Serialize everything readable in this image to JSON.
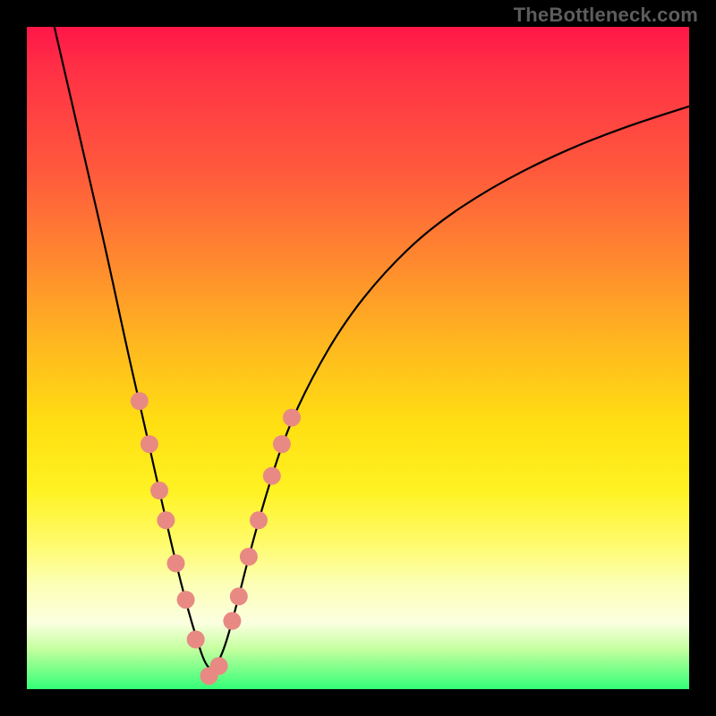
{
  "attribution": "TheBottleneck.com",
  "colors": {
    "background": "#000000",
    "gradient_stops": [
      {
        "pos": 0.0,
        "hex": "#ff1648"
      },
      {
        "pos": 0.06,
        "hex": "#ff2f46"
      },
      {
        "pos": 0.22,
        "hex": "#ff5a3c"
      },
      {
        "pos": 0.36,
        "hex": "#ff8b2e"
      },
      {
        "pos": 0.48,
        "hex": "#ffb81f"
      },
      {
        "pos": 0.6,
        "hex": "#ffdf12"
      },
      {
        "pos": 0.7,
        "hex": "#fff223"
      },
      {
        "pos": 0.78,
        "hex": "#fffb6b"
      },
      {
        "pos": 0.84,
        "hex": "#fcffb4"
      },
      {
        "pos": 0.9,
        "hex": "#fbffe0"
      },
      {
        "pos": 0.94,
        "hex": "#c3ff9e"
      },
      {
        "pos": 1.0,
        "hex": "#33ff77"
      }
    ],
    "curve": "#000000",
    "curve_width": 2.2,
    "marker_fill": "#e88a83",
    "marker_radius": 10
  },
  "chart_data": {
    "type": "line",
    "title": "",
    "xlabel": "",
    "ylabel": "",
    "xlim": [
      0,
      1
    ],
    "ylim": [
      0,
      1
    ],
    "x_min_curve": 0.275,
    "series": [
      {
        "name": "v-curve",
        "x": [
          0.0,
          0.03,
          0.06,
          0.09,
          0.12,
          0.15,
          0.175,
          0.2,
          0.225,
          0.25,
          0.275,
          0.295,
          0.315,
          0.335,
          0.36,
          0.39,
          0.43,
          0.48,
          0.54,
          0.61,
          0.7,
          0.8,
          0.9,
          1.0
        ],
        "y": [
          1.18,
          1.05,
          0.92,
          0.79,
          0.66,
          0.52,
          0.41,
          0.3,
          0.19,
          0.095,
          0.02,
          0.05,
          0.12,
          0.2,
          0.29,
          0.384,
          0.47,
          0.555,
          0.63,
          0.697,
          0.757,
          0.808,
          0.848,
          0.88
        ]
      }
    ],
    "markers": {
      "name": "highlighted-points",
      "x": [
        0.17,
        0.185,
        0.2,
        0.21,
        0.225,
        0.24,
        0.255,
        0.275,
        0.29,
        0.31,
        0.32,
        0.335,
        0.35,
        0.37,
        0.385,
        0.4
      ],
      "y": [
        0.435,
        0.37,
        0.3,
        0.255,
        0.19,
        0.135,
        0.075,
        0.02,
        0.035,
        0.103,
        0.14,
        0.2,
        0.255,
        0.322,
        0.37,
        0.41
      ]
    }
  }
}
